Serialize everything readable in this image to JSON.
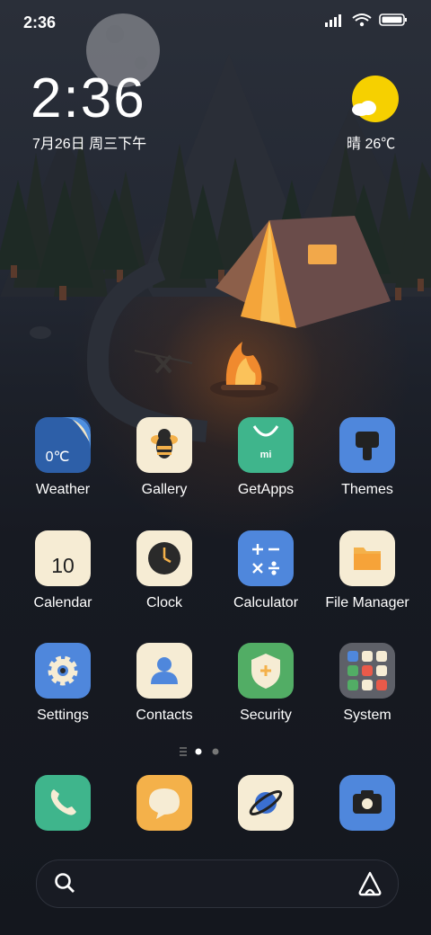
{
  "status": {
    "time": "2:36"
  },
  "clock": {
    "time": "2:36",
    "date": "7月26日 周三下午"
  },
  "weather": {
    "text": "晴 26℃"
  },
  "apps": [
    {
      "label": "Weather",
      "icon": "weather-icon",
      "badge": "0℃"
    },
    {
      "label": "Gallery",
      "icon": "gallery-icon"
    },
    {
      "label": "GetApps",
      "icon": "getapps-icon",
      "badge": "mi"
    },
    {
      "label": "Themes",
      "icon": "themes-icon"
    },
    {
      "label": "Calendar",
      "icon": "calendar-icon",
      "badge": "10"
    },
    {
      "label": "Clock",
      "icon": "clock-icon"
    },
    {
      "label": "Calculator",
      "icon": "calculator-icon"
    },
    {
      "label": "File Manager",
      "icon": "folder-icon"
    },
    {
      "label": "Settings",
      "icon": "gear-icon"
    },
    {
      "label": "Contacts",
      "icon": "contact-icon"
    },
    {
      "label": "Security",
      "icon": "shield-icon"
    },
    {
      "label": "System",
      "icon": "folder-grid-icon"
    }
  ],
  "dock": [
    "phone-icon",
    "message-icon",
    "browser-icon",
    "camera-icon"
  ],
  "pager": {
    "current_page": 1,
    "pages": 2
  },
  "search": {
    "placeholder": ""
  }
}
